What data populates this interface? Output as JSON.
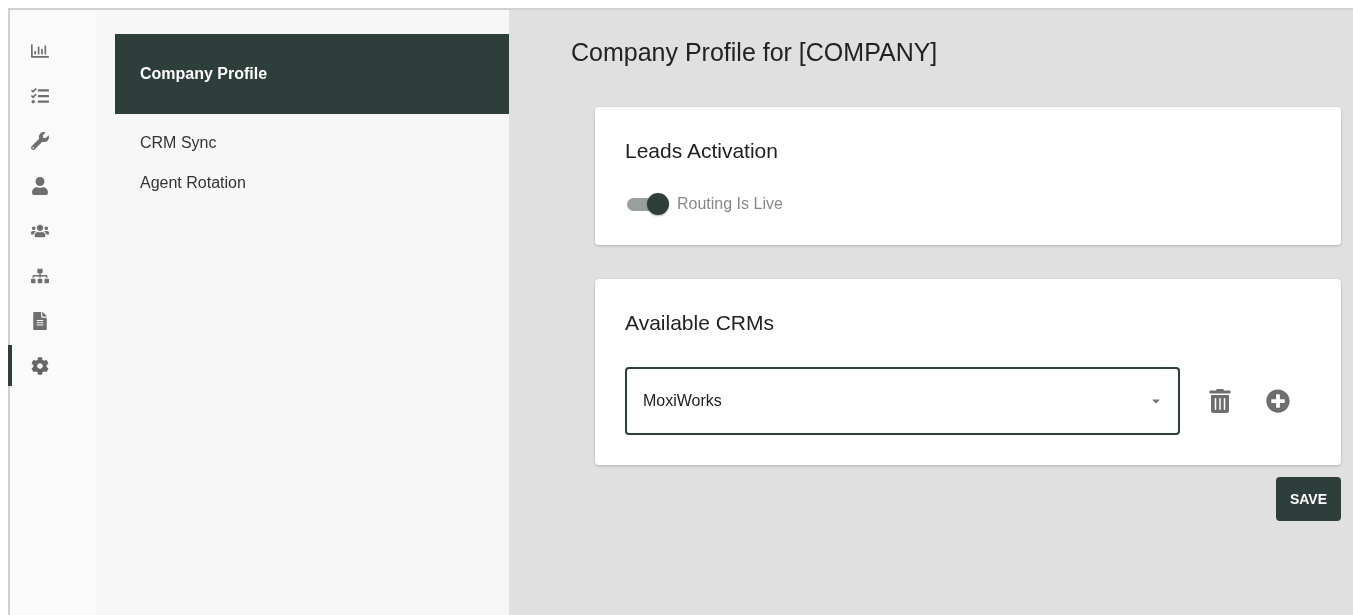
{
  "rail": [
    {
      "kind": "chart",
      "selected": false
    },
    {
      "kind": "tasks",
      "selected": false
    },
    {
      "kind": "wrench",
      "selected": false
    },
    {
      "kind": "user",
      "selected": false
    },
    {
      "kind": "users",
      "selected": false
    },
    {
      "kind": "sitemap",
      "selected": false
    },
    {
      "kind": "file",
      "selected": false
    },
    {
      "kind": "settings",
      "selected": true
    }
  ],
  "nav": [
    {
      "label": "Company Profile",
      "selected": true
    },
    {
      "label": "CRM Sync",
      "selected": false
    },
    {
      "label": "Agent Rotation",
      "selected": false
    }
  ],
  "page_title": "Company Profile for [COMPANY]",
  "leads_card": {
    "title": "Leads Activation",
    "toggle": {
      "label": "Routing Is Live",
      "on": true
    }
  },
  "crm_card": {
    "title": "Available CRMs",
    "select": {
      "value": "MoxiWorks"
    }
  },
  "save_button": "SAVE"
}
